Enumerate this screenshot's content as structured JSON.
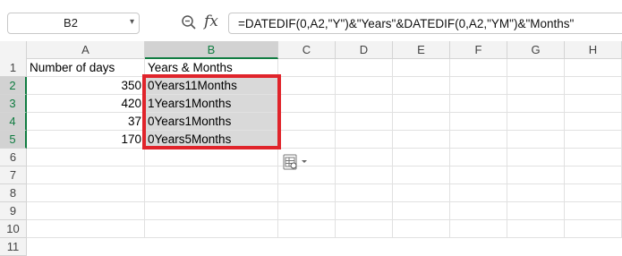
{
  "formula_bar": {
    "name_box": "B2",
    "formula": "=DATEDIF(0,A2,\"Y\")&\"Years\"&DATEDIF(0,A2,\"YM\")&\"Months\""
  },
  "columns": [
    "A",
    "B",
    "C",
    "D",
    "E",
    "F",
    "G",
    "H"
  ],
  "selected_column": "B",
  "rows": [
    "1",
    "2",
    "3",
    "4",
    "5",
    "6",
    "7",
    "8",
    "9",
    "10",
    "11"
  ],
  "cells": {
    "A1": "Number of days",
    "B1": "Years & Months",
    "A2": "350",
    "B2": "0Years11Months",
    "A3": "420",
    "B3": "1Years1Months",
    "A4": "37",
    "B4": "0Years1Months",
    "A5": "170",
    "B5": "0Years5Months"
  },
  "colors": {
    "accent": "#107c41",
    "highlight_border": "#e0242b",
    "selection_fill": "#d9d9d9"
  },
  "icons": [
    "zoom-icon",
    "fx-icon",
    "paste-options-icon"
  ]
}
